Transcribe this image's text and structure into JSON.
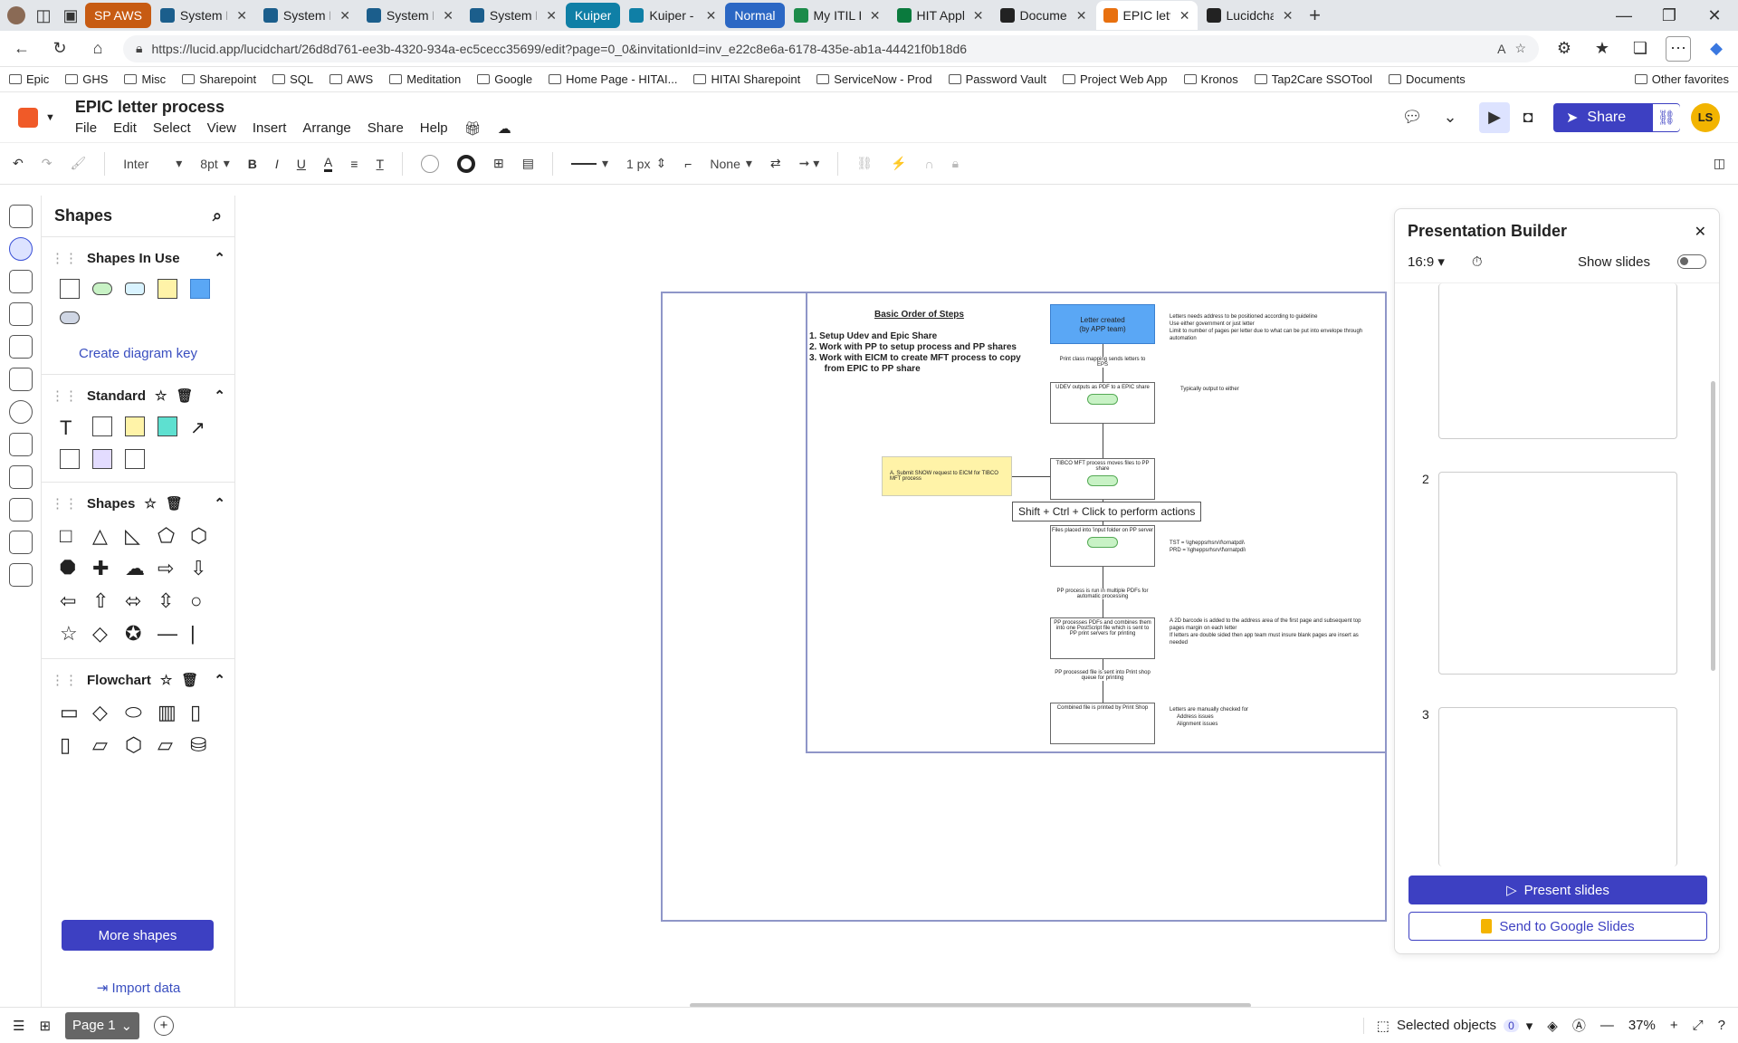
{
  "browser": {
    "tabs": [
      {
        "label": "SP AWS",
        "color": "#c75b12",
        "badge": true
      },
      {
        "label": "System Pulse D",
        "color": "#1b5e8c"
      },
      {
        "label": "System Pulse D",
        "color": "#1b5e8c"
      },
      {
        "label": "System Pulse D",
        "color": "#1b5e8c"
      },
      {
        "label": "System Pulse D",
        "color": "#1b5e8c"
      },
      {
        "label": "Kuiper",
        "color": "#0f7fa6",
        "badge": true
      },
      {
        "label": "Kuiper - Dashb",
        "color": "#0f7fa6"
      },
      {
        "label": "Normal",
        "color": "#2b67c4",
        "badge": true
      },
      {
        "label": "My ITIL Home",
        "color": "#1c8b4a"
      },
      {
        "label": "HIT Applicatio",
        "color": "#0a7a3d"
      },
      {
        "label": "Documents",
        "color": "#222222"
      },
      {
        "label": "EPIC letter pro",
        "color": "#e8700f",
        "active": true
      },
      {
        "label": "Lucidchart pre",
        "color": "#222222"
      }
    ],
    "url": "https://lucid.app/lucidchart/26d8d761-ee3b-4320-934a-ec5cecc35699/edit?page=0_0&invitationId=inv_e22c8e6a-6178-435e-ab1a-44421f0b18d6",
    "bookmarks": [
      "Epic",
      "GHS",
      "Misc",
      "Sharepoint",
      "SQL",
      "AWS",
      "Meditation",
      "Google",
      "Home Page - HITAI...",
      "HITAI Sharepoint",
      "ServiceNow - Prod",
      "Password Vault",
      "Project Web App",
      "Kronos",
      "Tap2Care SSOTool",
      "Documents"
    ],
    "other_favorites": "Other favorites"
  },
  "app": {
    "title": "EPIC letter process",
    "menu": [
      "File",
      "Edit",
      "Select",
      "View",
      "Insert",
      "Arrange",
      "Share",
      "Help"
    ],
    "share_label": "Share",
    "avatar": "LS"
  },
  "toolbar": {
    "font": "Inter",
    "font_size": "8pt",
    "line_width": "1 px",
    "arrow_start": "None"
  },
  "shapes_panel": {
    "title": "Shapes",
    "sections": {
      "in_use": "Shapes In Use",
      "standard": "Standard",
      "shapes": "Shapes",
      "flowchart": "Flowchart"
    },
    "create_key": "Create diagram key",
    "more_shapes": "More shapes",
    "import_data": "Import data"
  },
  "diagram": {
    "title": "Basic Order of Steps",
    "steps": [
      "1.  Setup Udev and Epic Share",
      "2.  Work with PP to setup process and PP  shares",
      "3.  Work with EICM to create MFT process to copy",
      "      from EPIC to PP share"
    ],
    "boxes": [
      "Letter created",
      "(by APP team)",
      "Print class mapping sends letters to EPS",
      "UDEV outputs as PDF to a EPIC share",
      "TIBCO MFT process moves files to PP share",
      "Files placed into 'input folder on PP server",
      "PP process is run in multiple PDFs for automatic processing",
      "PP processes PDFs and combines them into one PostScript file which is sent to PP print servers for printing",
      "PP processed file is sent into Print shop queue for printing",
      "Combined file is printed by Print Shop"
    ],
    "yellow_note": "A.  Submit SNOW request to EICM for TIBCO MFT process",
    "tooltip": "Shift + Ctrl + Click to perform actions",
    "notes": [
      "Letters needs address to be positioned according to guideline",
      "Use either government or just letter",
      "Limit to number of pages per letter due to what can be put into envelope through automation",
      "Typically output to either",
      "TST = \\\\gheppsrhsrv\\f\\ornatpdi\\",
      "PRD = \\\\gheppsrhsrv\\f\\ornatpdi\\",
      "A 2D barcode is added to the address area of the first page and subsequent top pages margin on each letter",
      "If letters are double sided then app team must insure blank pages are insert as needed",
      "Letters are manually checked for",
      "Address issues",
      "Alignment issues"
    ]
  },
  "presentation": {
    "title": "Presentation Builder",
    "ratio": "16:9",
    "show_slides": "Show slides",
    "slide_numbers": [
      "2",
      "3"
    ],
    "present": "Present slides",
    "google": "Send to Google Slides"
  },
  "status": {
    "page": "Page 1",
    "selected": "Selected objects",
    "selected_count": "0",
    "zoom": "37%"
  },
  "colors": {
    "accent": "#3d40c2",
    "yellow": "#fff3a8",
    "blue_box": "#5aa7f5",
    "green_pill": "#c8f2c5"
  }
}
